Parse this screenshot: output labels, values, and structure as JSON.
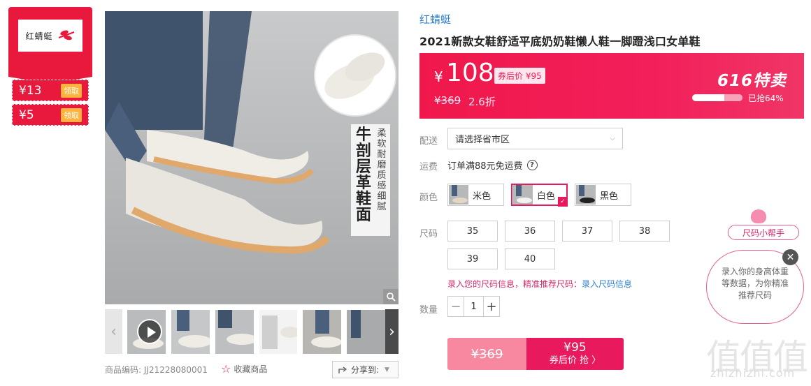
{
  "coupons": {
    "brand_logo_text": "红蜻蜓",
    "items": [
      {
        "amount": "¥13",
        "action": "领取"
      },
      {
        "amount": "¥5",
        "action": "领取"
      }
    ]
  },
  "gallery": {
    "main_image_text_big": "牛剖层革鞋面",
    "main_image_text_small": "柔软耐磨质感细腻",
    "product_code_label": "商品编码:",
    "product_code": "JJ21228080001",
    "favorite_label": "收藏商品",
    "share_label": "分享到:"
  },
  "product": {
    "shop_name": "红蜻蜓",
    "title": "2021新款女鞋舒适平底奶奶鞋懒人鞋一脚蹬浅口女单鞋"
  },
  "price": {
    "currency": "¥",
    "current": "108",
    "after_coupon": "券后价 ¥95",
    "original": "¥369",
    "discount": "2.6折",
    "promo_logo": "616特卖",
    "sold_progress": 0.64,
    "sold_text": "已抢64%"
  },
  "form": {
    "delivery_label": "配送",
    "region_placeholder": "请选择省市区",
    "shipping_label": "运费",
    "shipping_text": "订单满88元免运费",
    "color_label": "颜色",
    "colors": [
      {
        "name": "米色",
        "selected": false
      },
      {
        "name": "白色",
        "selected": true
      },
      {
        "name": "黑色",
        "selected": false
      }
    ],
    "size_label": "尺码",
    "sizes": [
      "35",
      "36",
      "37",
      "38",
      "39",
      "40"
    ],
    "size_hint_pink": "录入您的尺码信息，精准推荐尺码：",
    "size_hint_link": "录入尺码信息",
    "qty_label": "数量",
    "qty_value": "1",
    "qty_minus": "−",
    "qty_plus": "+"
  },
  "buy": {
    "original": "¥369",
    "coupon_price": "¥95",
    "coupon_action": "券后价 抢 〉"
  },
  "helper": {
    "tag": "尺码小帮手",
    "bubble_text": "录入你的身高体重等数据，为你精准推荐尺码",
    "close": "✕"
  },
  "watermark": {
    "main": "值值值",
    "sub": "zhizhizhi.com"
  },
  "colors": {
    "accent": "#e8195c",
    "link": "#2f7fcf",
    "coupon_red": "#e8193c"
  }
}
